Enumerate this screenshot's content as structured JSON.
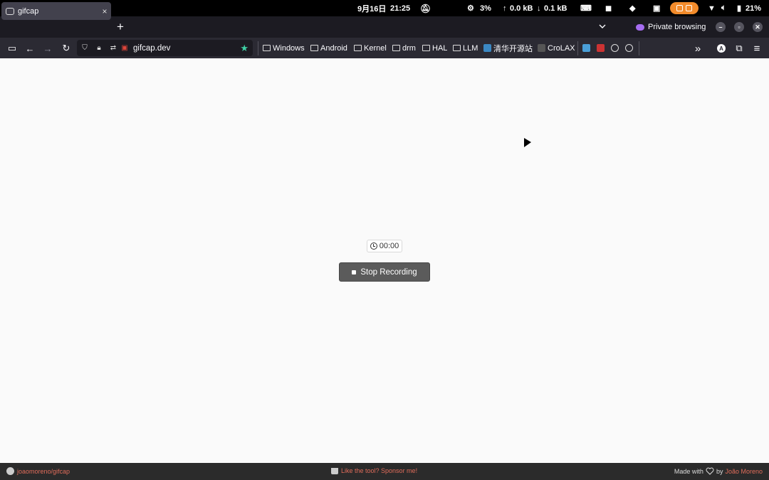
{
  "system_bar": {
    "date": "9月16日",
    "time": "21:25",
    "cpu": "3%",
    "upload": "0.0 kB",
    "download": "0.1 kB",
    "battery": "21%"
  },
  "tab": {
    "title": "gifcap",
    "close": "×",
    "new_tab": "+"
  },
  "window": {
    "private_label": "Private browsing",
    "minimize": "–",
    "restore": "▫",
    "close": "✕"
  },
  "nav": {
    "back": "←",
    "forward": "→",
    "reload": "↻",
    "url": "gifcap.dev",
    "bookmarks": [
      "Windows",
      "Android",
      "Kernel",
      "drm",
      "HAL",
      "LLM",
      "清华开源站",
      "CroLAX"
    ],
    "overflow": "»",
    "menu": "≡"
  },
  "page": {
    "timer": "00:00",
    "stop_button": "Stop Recording"
  },
  "footer": {
    "repo": "joaomoreno/gifcap",
    "sponsor": "Like the tool? Sponsor me!",
    "made_with": "Made with",
    "by": "by",
    "author": "João Moreno"
  },
  "colors": {
    "accent_star": "#3fd0a5",
    "record_pill": "#f28b2b",
    "footer_link": "#e06c5a"
  }
}
